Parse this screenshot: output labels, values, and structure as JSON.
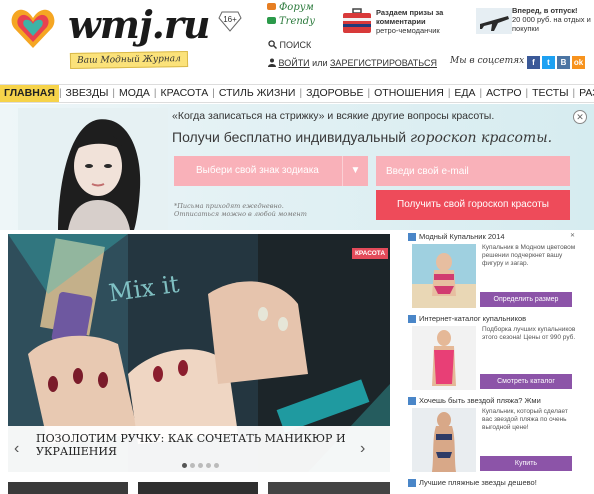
{
  "header": {
    "logo": "wmj.ru",
    "tagline": "Ваш Модный Журнал",
    "age": "16+",
    "forum": "Форум",
    "trendy": "Trendy",
    "search": "ПОИСК",
    "login": "ВОЙТИ",
    "or": "или",
    "register": "ЗАРЕГИСТРИРОВАТЬСЯ",
    "promo1_title": "Раздаем призы за комментарии",
    "promo1_sub": "ретро-чемоданчик",
    "promo2_title": "Вперед, в отпуск!",
    "promo2_sub": "20 000 руб. на отдых и покупки",
    "social_label": "Мы в соцсетях –",
    "social": [
      "f",
      "t",
      "B",
      "ok"
    ],
    "colors": {
      "facebook": "#3b5998",
      "twitter": "#1da1f2",
      "vk": "#4c75a3",
      "ok": "#f7931e"
    }
  },
  "nav": {
    "items": [
      "ГЛАВНАЯ",
      "ЗВЕЗДЫ",
      "МОДА",
      "КРАСОТА",
      "СТИЛЬ ЖИЗНИ",
      "ЗДОРОВЬЕ",
      "ОТНОШЕНИЯ",
      "ЕДА",
      "АСТРО",
      "ТЕСТЫ",
      "РАЗВЛЕЧЕНИЯ"
    ],
    "active": "ГЛАВНАЯ"
  },
  "banner": {
    "quote": "«Когда записаться на стрижку» и всякие другие вопросы красоты.",
    "title_plain": "Получи бесплатно индивидуальный ",
    "title_italic": "гороскоп красоты.",
    "sign_select": "Выбери свой знак зодиака",
    "email_placeholder": "Введи свой e-mail",
    "note_line1": "*Письма приходят ежедневно.",
    "note_line2": "Отписаться можно в любой момент",
    "button": "Получить свой гороскоп красоты",
    "close": "✕"
  },
  "article": {
    "tag": "КРАСОТА",
    "overlay_text": "Mix it",
    "title": "Позолотим ручку: как сочетать маникюр и украшения",
    "slides": 5,
    "active_slide": 1,
    "prev": "‹",
    "next": "›"
  },
  "ads": [
    {
      "title": "Модный Купальник 2014",
      "text": "Купальник в Модном цветовом решении подчеркнет вашу фигуру и загар.",
      "button": "Определить размер"
    },
    {
      "title": "Интернет-каталог купальников",
      "text": "Подборка лучших купальников этого сезона! Цены от 990 руб.",
      "button": "Смотреть каталог"
    },
    {
      "title": "Хочешь быть звездой пляжа? Жми",
      "text": "Купальник, который сделает вас звездой пляжа по очень выгодной цене!",
      "button": "Купить"
    },
    {
      "title": "Лучшие пляжные звезды дешево!",
      "text": "",
      "button": ""
    }
  ]
}
